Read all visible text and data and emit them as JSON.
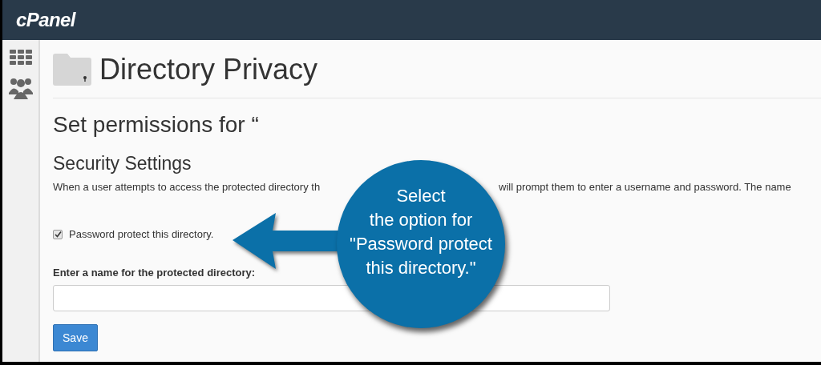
{
  "header": {
    "logo": "cPanel"
  },
  "page": {
    "title": "Directory Privacy",
    "subtitle": "Set permissions for “",
    "section": "Security Settings",
    "description_start": "When a user attempts to access the protected directory th",
    "description_end": "will prompt them to enter a username and password. The name"
  },
  "protect_option": {
    "label": "Password protect this directory.",
    "checked": true
  },
  "name_field": {
    "label": "Enter a name for the protected directory:"
  },
  "save_button": "Save",
  "callout": {
    "lines": [
      "Select",
      "the option for",
      "\"Password protect",
      "this directory.\""
    ]
  }
}
